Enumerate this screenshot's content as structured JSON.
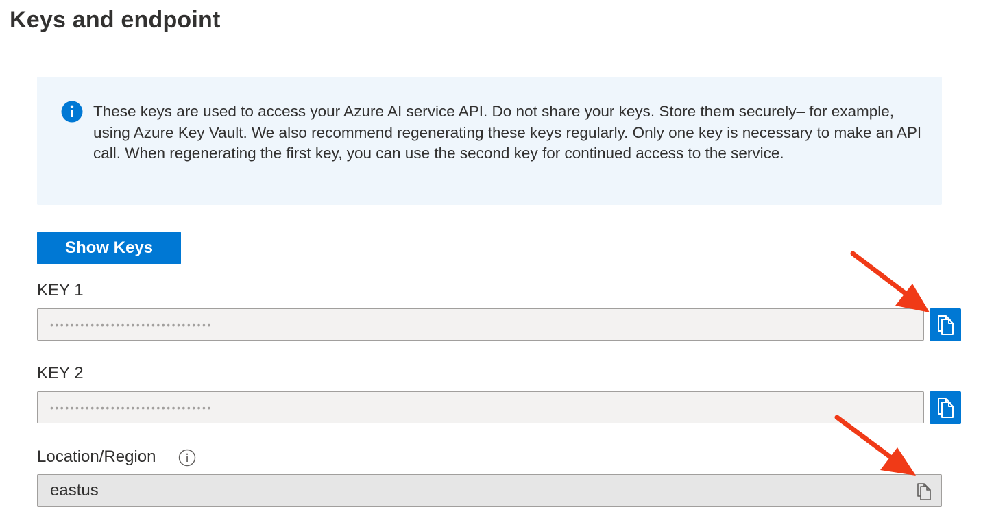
{
  "page": {
    "title": "Keys and endpoint"
  },
  "banner": {
    "icon": "info-icon",
    "text": "These keys are used to access your Azure AI service API. Do not share your keys. Store them securely– for example, using Azure Key Vault. We also recommend regenerating these keys regularly. Only one key is necessary to make an API call. When regenerating the first key, you can use the second key for continued access to the service."
  },
  "actions": {
    "show_keys_label": "Show Keys"
  },
  "keys": [
    {
      "label": "KEY 1",
      "masked_value": "••••••••••••••••••••••••••••••••",
      "copy_icon": "copy-icon"
    },
    {
      "label": "KEY 2",
      "masked_value": "••••••••••••••••••••••••••••••••",
      "copy_icon": "copy-icon"
    }
  ],
  "region": {
    "label": "Location/Region",
    "info_icon": "info-circle-icon",
    "value": "eastus",
    "copy_icon": "copy-icon"
  },
  "colors": {
    "accent": "#0078d4",
    "banner_bg": "#eff6fc",
    "field_bg": "#f3f2f1",
    "region_bg": "#e6e6e6",
    "annotation_arrow": "#f03a17"
  }
}
